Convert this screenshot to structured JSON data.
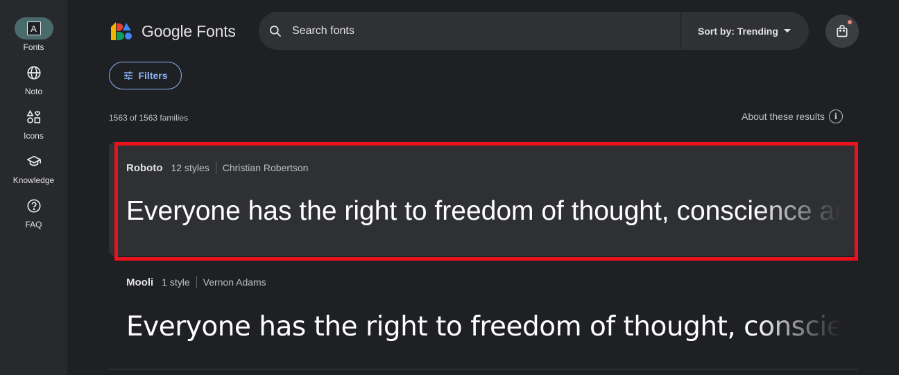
{
  "rail": {
    "items": [
      {
        "label": "Fonts",
        "icon": "fonts-icon",
        "active": true
      },
      {
        "label": "Noto",
        "icon": "globe-icon"
      },
      {
        "label": "Icons",
        "icon": "shapes-icon"
      },
      {
        "label": "Knowledge",
        "icon": "school-icon"
      },
      {
        "label": "FAQ",
        "icon": "help-icon"
      }
    ],
    "fonts_glyph": "A"
  },
  "header": {
    "logo_text": "Google Fonts",
    "search_placeholder": "Search fonts",
    "sort_label": "Sort by: Trending"
  },
  "toolbar": {
    "filters_label": "Filters",
    "results_count": "1563 of 1563 families",
    "about_label": "About these results",
    "about_glyph": "i"
  },
  "fonts": [
    {
      "name": "Roboto",
      "styles": "12 styles",
      "author": "Christian Robertson",
      "preview": "Everyone has the right to freedom of thought, conscience and religion"
    },
    {
      "name": "Mooli",
      "styles": "1 style",
      "author": "Vernon Adams",
      "preview": "Everyone has the right to freedom of thought, conscience and religion"
    }
  ],
  "colors": {
    "accent": "#8ab4f8",
    "highlight": "#e8121f",
    "rail_active": "#4a6b6b",
    "background": "#1f2023"
  }
}
